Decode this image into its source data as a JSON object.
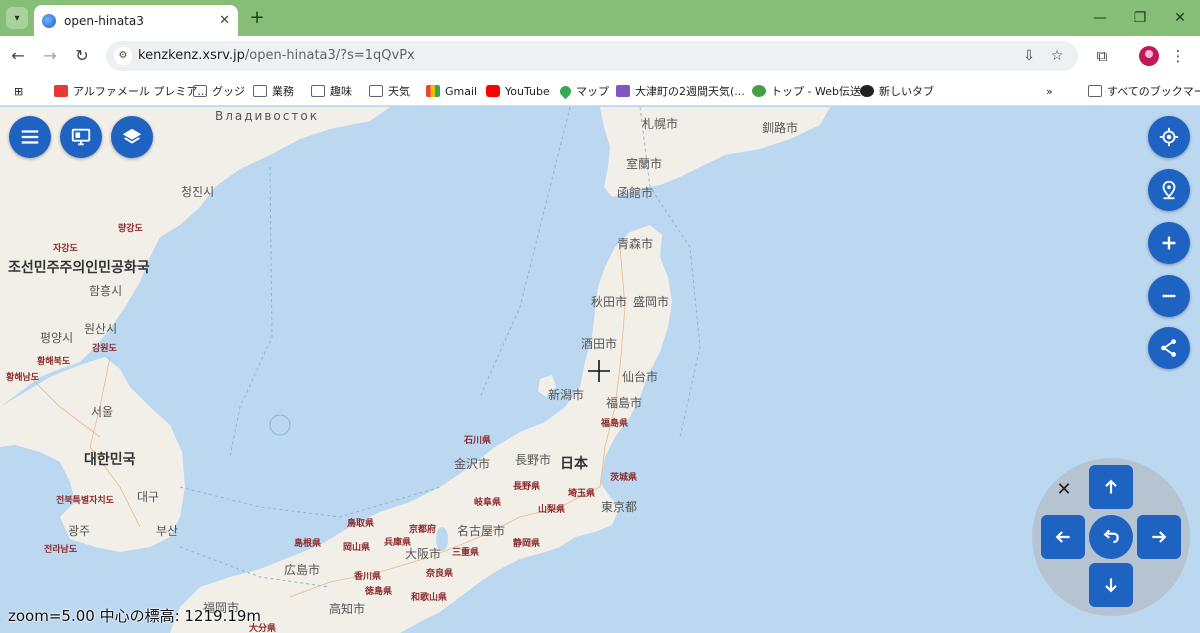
{
  "browser": {
    "tab_title": "open-hinata3",
    "url_host": "kenzkenz.xsrv.jp",
    "url_path": "/open-hinata3/?s=1qQvPx",
    "bookmarks": [
      {
        "label": "アルファメール プレミア...",
        "icon": "alpha-icon"
      },
      {
        "label": "グッジ",
        "icon": "folder-icon"
      },
      {
        "label": "業務",
        "icon": "folder-icon"
      },
      {
        "label": "趣味",
        "icon": "folder-icon"
      },
      {
        "label": "天気",
        "icon": "folder-icon"
      },
      {
        "label": "Gmail",
        "icon": "gmail-icon"
      },
      {
        "label": "YouTube",
        "icon": "youtube-icon"
      },
      {
        "label": "マップ",
        "icon": "maps-icon"
      },
      {
        "label": "大津町の2週間天気(...",
        "icon": "weather-icon"
      },
      {
        "label": "トップ - Web伝送",
        "icon": "web-icon"
      },
      {
        "label": "新しいタブ",
        "icon": "globe-icon"
      }
    ],
    "all_bookmarks_label": "すべてのブックマーク"
  },
  "map": {
    "labels": {
      "vladivostok": "Владивосток",
      "sapporo": "札幌市",
      "kushiro": "釧路市",
      "muroran": "室蘭市",
      "hakodate": "函館市",
      "aomori": "青森市",
      "akita": "秋田市",
      "morioka": "盛岡市",
      "sakata": "酒田市",
      "sendai": "仙台市",
      "niigata": "新潟市",
      "fukushima": "福島市",
      "fukushima_pref": "福島県",
      "ishikawa_pref": "石川県",
      "kanazawa": "金沢市",
      "nagano": "長野市",
      "japan": "日本",
      "ibaraki_pref": "茨城県",
      "nagano_pref": "長野県",
      "saitama_pref": "埼玉県",
      "gifu_pref": "岐阜県",
      "yamanashi_pref": "山梨県",
      "tokyo": "東京都",
      "tottori_pref": "鳥取県",
      "kyoto": "京都府",
      "nagoya": "名古屋市",
      "shimane_pref": "島根県",
      "okayama_pref": "岡山県",
      "hyogo_pref": "兵庫県",
      "shizuoka_pref": "静岡県",
      "osaka": "大阪市",
      "mie_pref": "三重県",
      "hiroshima": "広島市",
      "kagawa_pref": "香川県",
      "nara_pref": "奈良県",
      "tokushima_pref": "徳島県",
      "wakayama_pref": "和歌山県",
      "kochi": "高知市",
      "fukuoka": "福岡市",
      "oita_pref": "大分県",
      "chongjin": "청진시",
      "ryanggang": "량강도",
      "jagang": "자강도",
      "dprk": "조선민주주의인민공화국",
      "hamhung": "함흥시",
      "pyongyang": "평양시",
      "wonsan": "원산시",
      "gangwon": "강원도",
      "hwanghae_n": "황해북도",
      "hwanghae_s": "황해남도",
      "seoul": "서울",
      "korea": "대한민국",
      "jeonbuk": "전북특별자치도",
      "daegu": "대구",
      "gwangju": "광주",
      "busan": "부산",
      "jeonnam": "전라남도"
    },
    "status": "zoom=5.00 中心の標高: 1219.19m"
  }
}
